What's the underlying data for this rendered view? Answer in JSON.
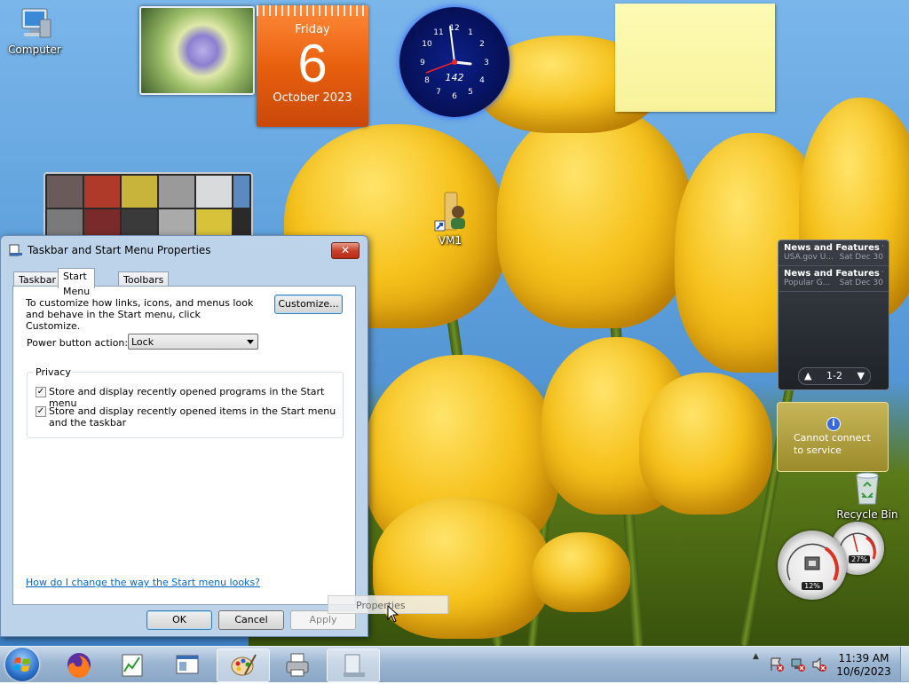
{
  "desktop": {
    "icons": {
      "computer": "Computer",
      "vm1": "VM1",
      "recycle_bin": "Recycle Bin"
    }
  },
  "gadgets": {
    "calendar": {
      "weekday": "Friday",
      "day": "6",
      "month_year": "October 2023"
    },
    "clock": {
      "label": "142"
    },
    "feed": {
      "items": [
        {
          "title": "News and Features f...",
          "source": "USA.gov U...",
          "date": "Sat Dec 30"
        },
        {
          "title": "News and Features f...",
          "source": "Popular G...",
          "date": "Sat Dec 30"
        }
      ],
      "pager": "1-2"
    },
    "weather": {
      "message": "Cannot connect to service"
    },
    "cpu_meter": {
      "cpu": "12%",
      "memory": "27%"
    }
  },
  "dialog": {
    "title": "Taskbar and Start Menu Properties",
    "close_glyph": "✕",
    "tabs": [
      "Taskbar",
      "Start Menu",
      "Toolbars"
    ],
    "active_tab": "Start Menu",
    "description": "To customize how links, icons, and menus look and behave in the Start menu, click Customize.",
    "customize_button": "Customize...",
    "power_label": "Power button action:",
    "power_value": "Lock",
    "privacy_legend": "Privacy",
    "privacy_options": [
      {
        "label": "Store and display recently opened programs in the Start menu",
        "checked": true
      },
      {
        "label": "Store and display recently opened items in the Start menu and the taskbar",
        "checked": true
      }
    ],
    "help_link": "How do I change the way the Start menu looks?",
    "ok": "OK",
    "cancel": "Cancel",
    "apply": "Apply"
  },
  "tooltip": {
    "text": "Properties"
  },
  "taskbar": {
    "clock_time": "11:39 AM",
    "clock_date": "10/6/2023"
  },
  "colors": {
    "accent": "#3c7fb1",
    "link": "#0066cc",
    "calendar": "#e8600e"
  }
}
